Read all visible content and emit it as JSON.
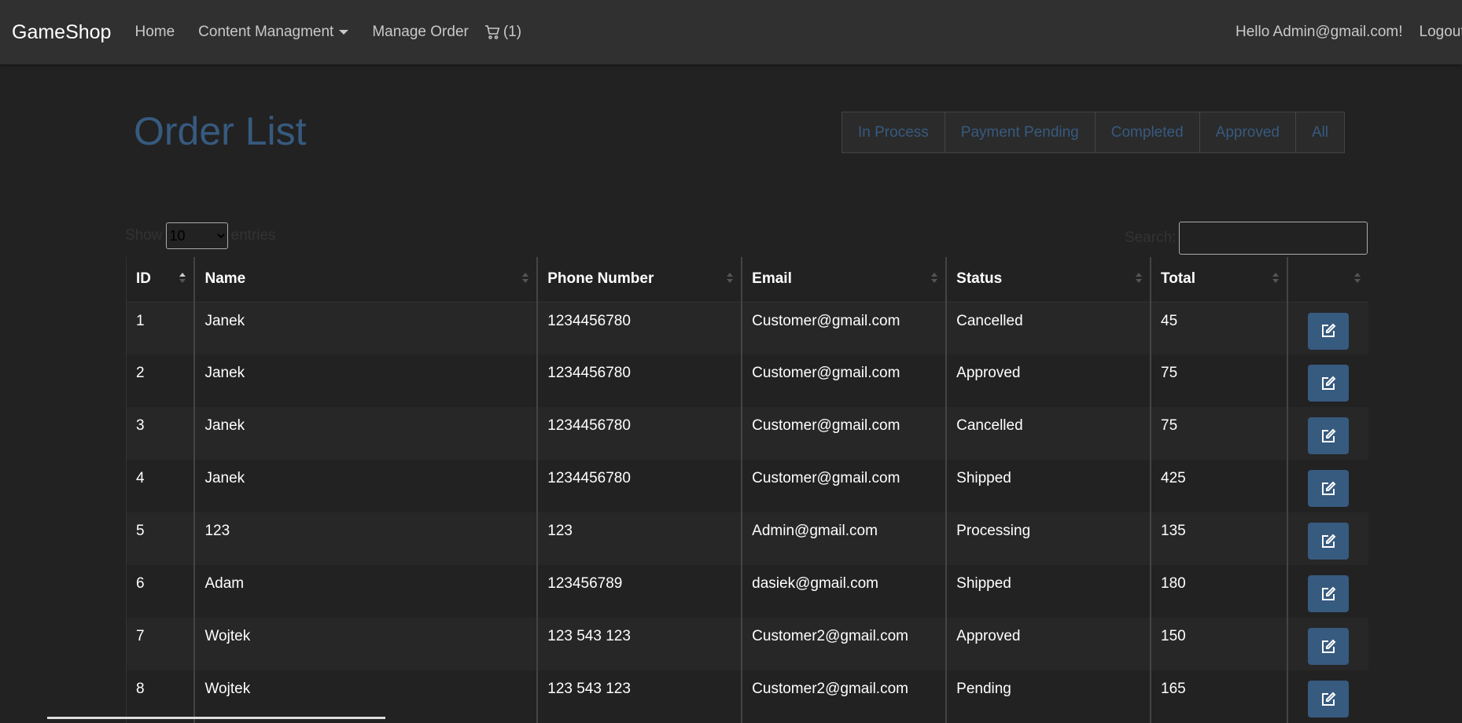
{
  "nav": {
    "brand": "GameShop",
    "home": "Home",
    "content": "Content Managment",
    "manage_order": "Manage Order",
    "cart_count": "(1)",
    "greeting": "Hello Admin@gmail.com!",
    "logout": "Logout"
  },
  "page": {
    "title": "Order List"
  },
  "filters": [
    "In Process",
    "Payment Pending",
    "Completed",
    "Approved",
    "All"
  ],
  "table_controls": {
    "show_label": "Show",
    "page_size": "10",
    "entries_label": "entries",
    "search_label": "Search:"
  },
  "columns": [
    "ID",
    "Name",
    "Phone Number",
    "Email",
    "Status",
    "Total",
    ""
  ],
  "rows": [
    {
      "id": "1",
      "name": "Janek",
      "phone": "1234456780",
      "email": "Customer@gmail.com",
      "status": "Cancelled",
      "total": "45"
    },
    {
      "id": "2",
      "name": "Janek",
      "phone": "1234456780",
      "email": "Customer@gmail.com",
      "status": "Approved",
      "total": "75"
    },
    {
      "id": "3",
      "name": "Janek",
      "phone": "1234456780",
      "email": "Customer@gmail.com",
      "status": "Cancelled",
      "total": "75"
    },
    {
      "id": "4",
      "name": "Janek",
      "phone": "1234456780",
      "email": "Customer@gmail.com",
      "status": "Shipped",
      "total": "425"
    },
    {
      "id": "5",
      "name": "123",
      "phone": "123",
      "email": "Admin@gmail.com",
      "status": "Processing",
      "total": "135"
    },
    {
      "id": "6",
      "name": "Adam",
      "phone": "123456789",
      "email": "dasiek@gmail.com",
      "status": "Shipped",
      "total": "180"
    },
    {
      "id": "7",
      "name": "Wojtek",
      "phone": "123 543 123",
      "email": "Customer2@gmail.com",
      "status": "Approved",
      "total": "150"
    },
    {
      "id": "8",
      "name": "Wojtek",
      "phone": "123 543 123",
      "email": "Customer2@gmail.com",
      "status": "Pending",
      "total": "165"
    }
  ],
  "colors": {
    "accent": "#375a7f",
    "background": "#222222",
    "navbar": "#303030"
  },
  "icons": {
    "cart": "cart-icon",
    "edit": "edit-icon"
  }
}
